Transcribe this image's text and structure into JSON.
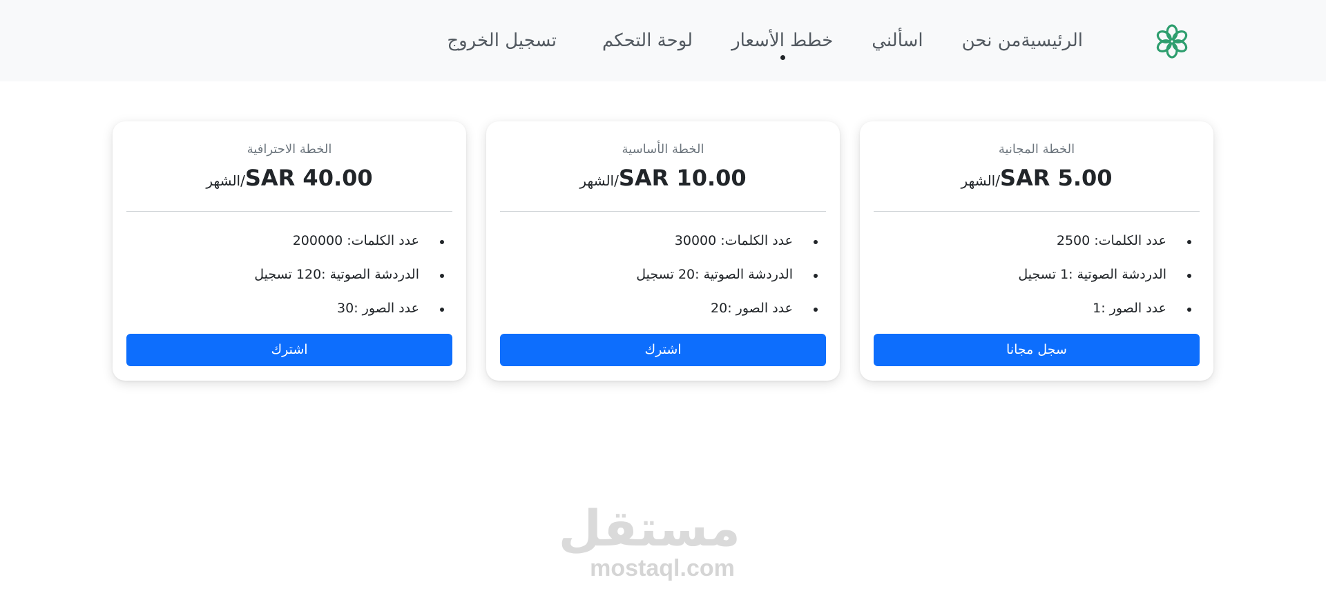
{
  "nav": {
    "logo_icon": "flower-logo-icon",
    "logo_color": "#2e9e6e",
    "items": [
      {
        "label": "الرئيسية"
      },
      {
        "label": "من نحن"
      },
      {
        "label": "اسألني"
      },
      {
        "label": "خطط الأسعار",
        "active": true
      },
      {
        "label": "لوحة التحكم"
      },
      {
        "label": "تسجيل الخروج"
      }
    ]
  },
  "plans": [
    {
      "title": "الخطة المجانية",
      "amount": "SAR 5.00",
      "period": "/الشهر",
      "features": [
        "عدد الكلمات: 2500",
        "الدردشة الصوتية :1 تسجيل",
        "عدد الصور :1"
      ],
      "button": "سجل مجانا"
    },
    {
      "title": "الخطة الأساسية",
      "amount": "SAR 10.00",
      "period": "/الشهر",
      "features": [
        "عدد الكلمات: 30000",
        "الدردشة الصوتية :20 تسجيل",
        "عدد الصور :20"
      ],
      "button": "اشترك"
    },
    {
      "title": "الخطة الاحترافية",
      "amount": "SAR 40.00",
      "period": "/الشهر",
      "features": [
        "عدد الكلمات: 200000",
        "الدردشة الصوتية :120 تسجيل",
        "عدد الصور :30"
      ],
      "button": "اشترك"
    }
  ],
  "colors": {
    "primary_button": "#0d6efd",
    "navbar_bg": "#f8f9fa"
  },
  "watermark": {
    "arabic": "مستقل",
    "latin": "mostaql.com"
  }
}
